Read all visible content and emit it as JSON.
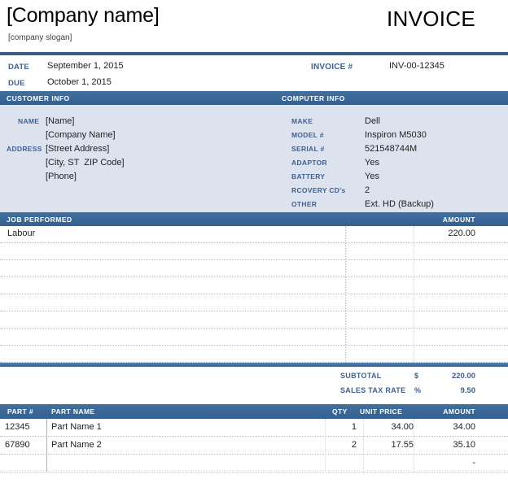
{
  "header": {
    "company_name": "[Company name]",
    "company_slogan": "[company slogan]",
    "doc_title": "INVOICE"
  },
  "meta": {
    "date_label": "DATE",
    "date_value": "September 1, 2015",
    "due_label": "DUE",
    "due_value": "October 1, 2015",
    "invoice_no_label": "INVOICE #",
    "invoice_no_value": "INV-00-12345"
  },
  "bands": {
    "customer_info": "CUSTOMER INFO",
    "computer_info": "COMPUTER INFO",
    "job_performed": "JOB PERFORMED",
    "amount": "AMOUNT"
  },
  "customer": {
    "name_label": "NAME",
    "address_label": "ADDRESS",
    "lines": [
      "[Name]",
      "[Company Name]",
      "[Street Address]",
      "[City, ST  ZIP Code]",
      "[Phone]"
    ]
  },
  "computer": {
    "rows": [
      {
        "key": "MAKE",
        "value": "Dell"
      },
      {
        "key": "MODEL #",
        "value": "Inspiron M5030"
      },
      {
        "key": "SERIAL #",
        "value": "521548744M"
      },
      {
        "key": "ADAPTOR",
        "value": "Yes"
      },
      {
        "key": "BATTERY",
        "value": "Yes"
      },
      {
        "key": "RCOVERY CD's",
        "value": "2"
      },
      {
        "key": "OTHER",
        "value": "Ext. HD (Backup)"
      }
    ]
  },
  "job_table": {
    "rows": [
      {
        "desc": "Labour",
        "amount": "220.00"
      },
      {
        "desc": "",
        "amount": ""
      },
      {
        "desc": "",
        "amount": ""
      },
      {
        "desc": "",
        "amount": ""
      },
      {
        "desc": "",
        "amount": ""
      },
      {
        "desc": "",
        "amount": ""
      },
      {
        "desc": "",
        "amount": ""
      },
      {
        "desc": "",
        "amount": ""
      }
    ]
  },
  "totals": {
    "subtotal_label": "SUBTOTAL",
    "subtotal_symbol": "$",
    "subtotal_value": "220.00",
    "tax_label": "SALES TAX RATE",
    "tax_symbol": "%",
    "tax_value": "9.50"
  },
  "parts_table": {
    "columns": {
      "part_no": "PART #",
      "part_name": "PART NAME",
      "qty": "QTY",
      "unit_price": "UNIT PRICE",
      "amount": "AMOUNT"
    },
    "rows": [
      {
        "part_no": "12345",
        "part_name": "Part Name 1",
        "qty": "1",
        "unit_price": "34.00",
        "amount": "34.00"
      },
      {
        "part_no": "67890",
        "part_name": "Part Name 2",
        "qty": "2",
        "unit_price": "17.55",
        "amount": "35.10"
      },
      {
        "part_no": "",
        "part_name": "",
        "qty": "",
        "unit_price": "",
        "amount": "-"
      }
    ]
  },
  "colors": {
    "band_blue": "#3a6aa8",
    "navy_rule": "#3a5a87",
    "panel_bg": "#dce3ef",
    "label_blue": "#3f6192"
  }
}
